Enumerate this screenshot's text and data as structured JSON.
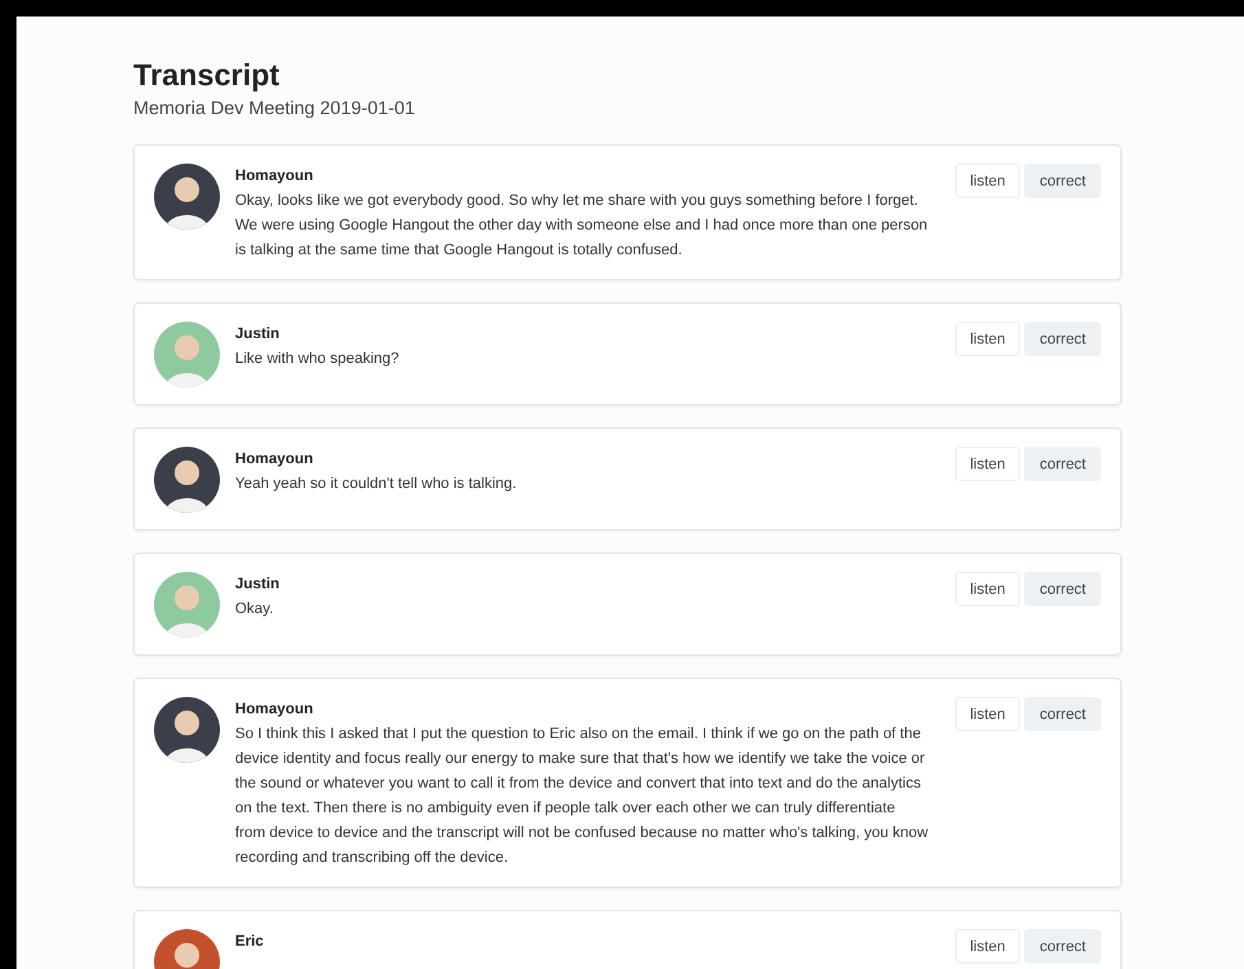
{
  "header": {
    "title": "Transcript",
    "subtitle": "Memoria Dev Meeting 2019-01-01"
  },
  "entries": [
    {
      "speaker": "Homayoun",
      "color": "#3a3f4a",
      "text": "Okay, looks like we got everybody good. So why let me share with you guys something before I forget. We were using Google Hangout the other day with someone else and I had once more than one person is talking at the same time that Google Hangout is totally confused.",
      "actions": [
        "listen",
        "correct"
      ]
    },
    {
      "speaker": "Justin",
      "color": "#8fc9a0",
      "text": "Like with who speaking?",
      "actions": [
        "listen",
        "correct"
      ]
    },
    {
      "speaker": "Homayoun",
      "color": "#3a3f4a",
      "text": "Yeah yeah so it couldn't tell who is talking.",
      "actions": [
        "listen",
        "correct"
      ]
    },
    {
      "speaker": "Justin",
      "color": "#8fc9a0",
      "text": "Okay.",
      "actions": [
        "listen",
        "correct"
      ]
    },
    {
      "speaker": "Homayoun",
      "color": "#3a3f4a",
      "text": "So I think this I asked that I put the question to Eric also on the email. I think if we go on the path of the device identity and focus really our energy to make sure that that's how we identify we take the voice or the sound or whatever you want to call it from the device and convert that into text and do the analytics on the text. Then there is no ambiguity even if people talk over each other we can truly differentiate from device to device and the transcript will not be confused because no matter who's talking, you know recording and transcribing off the device.",
      "actions": [
        "listen",
        "correct"
      ]
    },
    {
      "speaker": "Eric",
      "color": "#c4512e",
      "actions": [
        "listen",
        "correct"
      ]
    }
  ]
}
